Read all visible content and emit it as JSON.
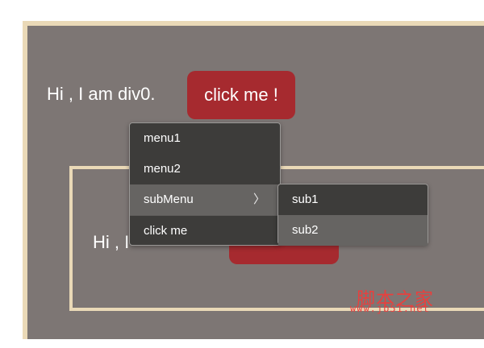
{
  "div0": {
    "text": "Hi , I am div0.",
    "button_label": "click me !"
  },
  "div1": {
    "text": "Hi , I"
  },
  "context_menu": {
    "items": [
      {
        "label": "menu1"
      },
      {
        "label": "menu2"
      },
      {
        "label": "subMenu",
        "arrow": "〉"
      },
      {
        "label": "click me"
      }
    ]
  },
  "submenu": {
    "items": [
      {
        "label": "sub1"
      },
      {
        "label": "sub2"
      }
    ]
  },
  "watermark": {
    "logo": "脚本之家",
    "url": "www.jb51.net"
  },
  "colors": {
    "panel_bg": "#7d7674",
    "border": "#ead9b7",
    "button": "#a62a2f",
    "menu_bg": "#3d3c3a",
    "menu_hover": "#666462",
    "watermark": "#e8403e"
  }
}
